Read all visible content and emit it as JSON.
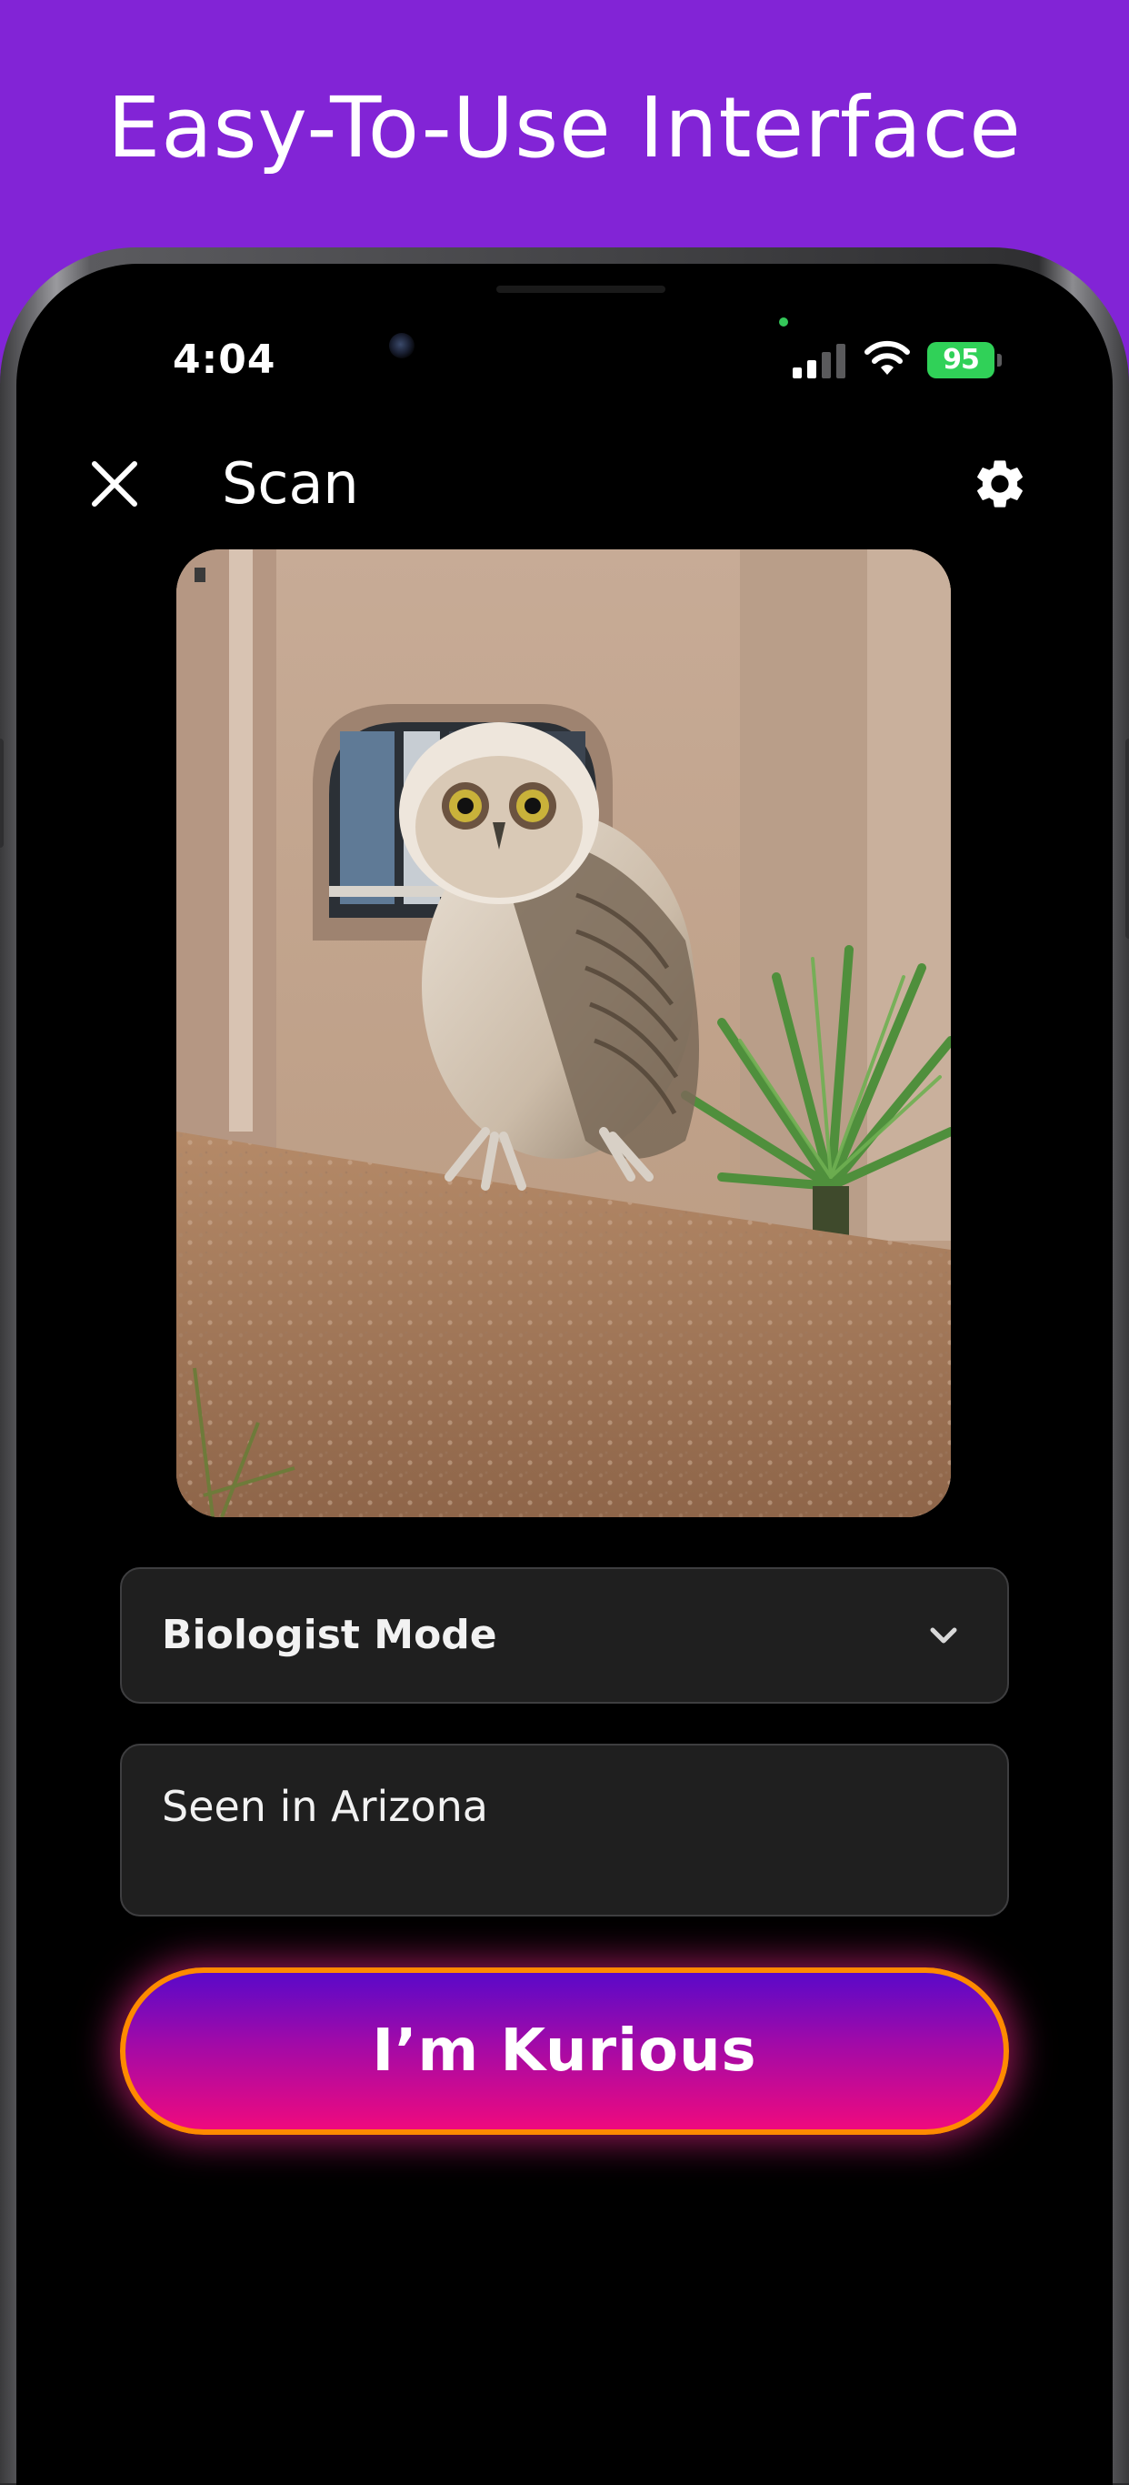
{
  "promo": {
    "headline": "Easy-To-Use Interface"
  },
  "status_bar": {
    "time": "4:04",
    "battery_percent": "95",
    "privacy_dot_color": "#34c759",
    "signal_icon": "signal-icon",
    "wifi_icon": "wifi-icon"
  },
  "header": {
    "close_icon": "close-icon",
    "title": "Scan",
    "settings_icon": "gear-icon"
  },
  "photo": {
    "subject": "owl-photo"
  },
  "mode_select": {
    "selected": "Biologist Mode",
    "icon": "chevron-down-icon"
  },
  "note_field": {
    "value": "Seen in Arizona"
  },
  "submit_button": {
    "label": "I’m Kurious"
  },
  "colors": {
    "background": "#8224d6",
    "screen": "#000000",
    "field_background": "#1f1f1f",
    "button_top": "#5a09c9",
    "button_bottom": "#ef0a7e",
    "button_border": "#ff8a00",
    "battery": "#30d158"
  }
}
